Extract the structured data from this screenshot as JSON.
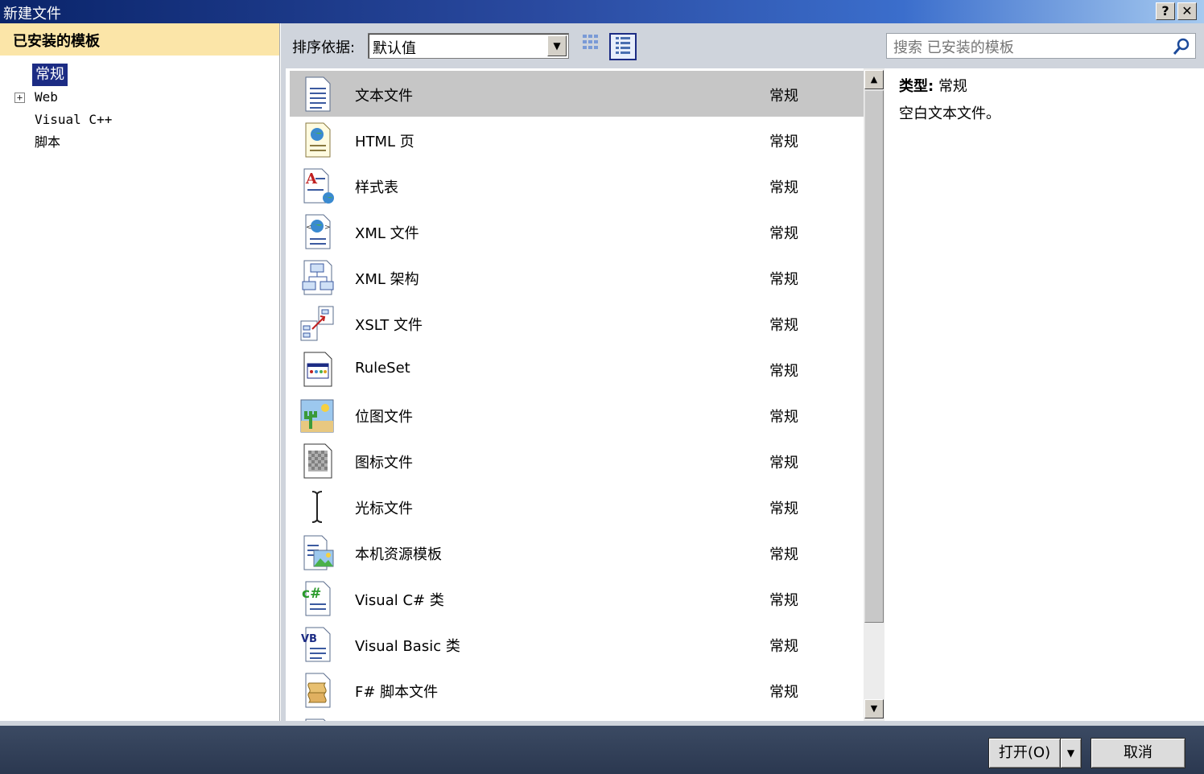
{
  "window": {
    "title": "新建文件",
    "help_label": "?",
    "close_label": "✕"
  },
  "left_panel": {
    "header": "已安装的模板",
    "tree": [
      {
        "label": "常规",
        "selected": true,
        "expandable": false
      },
      {
        "label": "Web",
        "selected": false,
        "expandable": true,
        "expander": "+"
      },
      {
        "label": "Visual C++",
        "selected": false,
        "expandable": false
      },
      {
        "label": "脚本",
        "selected": false,
        "expandable": false
      }
    ]
  },
  "toolbar": {
    "sort_label": "排序依据:",
    "sort_value": "默认值"
  },
  "search": {
    "placeholder": "搜索 已安装的模板"
  },
  "templates": [
    {
      "name": "文本文件",
      "category": "常规",
      "icon": "text-file-icon",
      "selected": true
    },
    {
      "name": "HTML 页",
      "category": "常规",
      "icon": "html-page-icon"
    },
    {
      "name": "样式表",
      "category": "常规",
      "icon": "stylesheet-icon"
    },
    {
      "name": "XML 文件",
      "category": "常规",
      "icon": "xml-file-icon"
    },
    {
      "name": "XML 架构",
      "category": "常规",
      "icon": "xml-schema-icon"
    },
    {
      "name": "XSLT 文件",
      "category": "常规",
      "icon": "xslt-file-icon"
    },
    {
      "name": "RuleSet",
      "category": "常规",
      "icon": "ruleset-icon"
    },
    {
      "name": "位图文件",
      "category": "常规",
      "icon": "bitmap-file-icon"
    },
    {
      "name": "图标文件",
      "category": "常规",
      "icon": "icon-file-icon"
    },
    {
      "name": "光标文件",
      "category": "常规",
      "icon": "cursor-file-icon"
    },
    {
      "name": "本机资源模板",
      "category": "常规",
      "icon": "native-resource-icon"
    },
    {
      "name": "Visual C# 类",
      "category": "常规",
      "icon": "csharp-class-icon"
    },
    {
      "name": "Visual Basic 类",
      "category": "常规",
      "icon": "vb-class-icon"
    },
    {
      "name": "F# 脚本文件",
      "category": "常规",
      "icon": "fsharp-script-icon"
    }
  ],
  "details": {
    "type_label": "类型:",
    "type_value": "常规",
    "description": "空白文本文件。"
  },
  "buttons": {
    "open": "打开(O)",
    "cancel": "取消"
  }
}
